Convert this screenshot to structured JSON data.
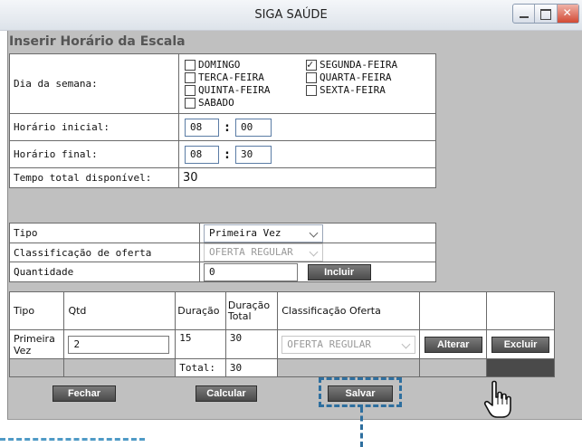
{
  "window": {
    "title": "SIGA SAÚDE"
  },
  "heading": "Inserir Horário da Escala",
  "form": {
    "weekday_label": "Dia da semana:",
    "days_col1": [
      {
        "label": "DOMINGO",
        "checked": false
      },
      {
        "label": "TERCA-FEIRA",
        "checked": false
      },
      {
        "label": "QUINTA-FEIRA",
        "checked": false
      },
      {
        "label": "SABADO",
        "checked": false
      }
    ],
    "days_col2": [
      {
        "label": "SEGUNDA-FEIRA",
        "checked": true
      },
      {
        "label": "QUARTA-FEIRA",
        "checked": false
      },
      {
        "label": "SEXTA-FEIRA",
        "checked": false
      }
    ],
    "start_label": "Horário inicial:",
    "start_hour": "08",
    "start_min": "00",
    "end_label": "Horário final:",
    "end_hour": "08",
    "end_min": "30",
    "total_label": "Tempo total disponível:",
    "total_value": "30"
  },
  "offer": {
    "tipo_label": "Tipo",
    "tipo_value": "Primeira Vez",
    "class_label": "Classificação de oferta",
    "class_value": "OFERTA REGULAR",
    "qty_label": "Quantidade",
    "qty_value": "0",
    "add_button": "Incluir"
  },
  "table": {
    "headers": [
      "Tipo",
      "Qtd",
      "Duração",
      "Duração Total",
      "Classificação Oferta"
    ],
    "rows": [
      {
        "tipo": "Primeira Vez",
        "qtd": "2",
        "duracao": "15",
        "duracao_total": "30",
        "classificacao": "OFERTA REGULAR",
        "edit": "Alterar",
        "delete": "Excluir"
      }
    ],
    "total_label": "Total:",
    "total_value": "30"
  },
  "buttons": {
    "close": "Fechar",
    "calc": "Calcular",
    "save": "Salvar"
  },
  "icons": {
    "cursor": "hand-pointer-icon"
  }
}
